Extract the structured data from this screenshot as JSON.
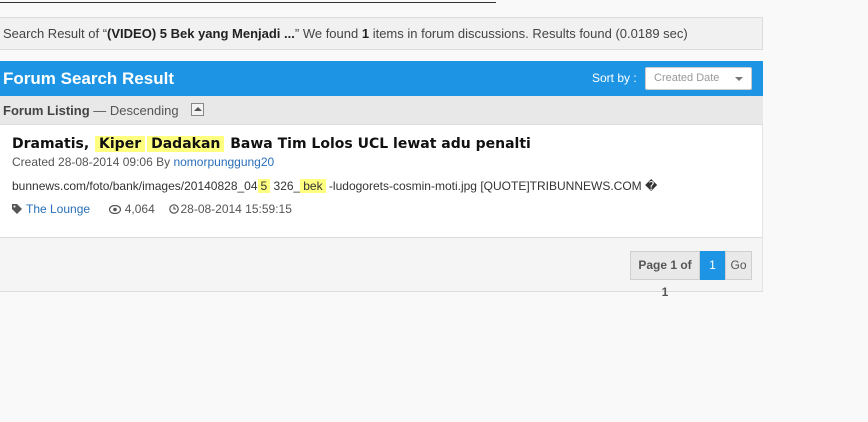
{
  "summary": {
    "prefix": "Search Result of “",
    "query": "(VIDEO) 5 Bek yang Menjadi ...",
    "middle": "” We found ",
    "count": "1",
    "suffix": " items in forum discussions. Results found (0.0189 sec)"
  },
  "header": {
    "title": "Forum Search Result",
    "sort_label": "Sort by :",
    "sort_value": "Created Date"
  },
  "listing": {
    "label": "Forum Listing",
    "order": " — Descending"
  },
  "result": {
    "title_parts": {
      "a": "Dramatis, ",
      "hl1": "Kiper",
      "hl2": "Dadakan",
      "b": " Bawa Tim Lolos UCL lewat adu penalti"
    },
    "created_prefix": "Created 28-08-2014 09:06 By ",
    "author": "nomorpunggung20",
    "snippet_parts": {
      "a": "bunnews.com/foto/bank/images/20140828_04",
      "hl1": "5",
      "b": " 326_",
      "hl2": "bek",
      "c": " -ludogorets-cosmin-moti.jpg [QUOTE]TRIBUNNEWS.COM �"
    },
    "forum": "The Lounge",
    "views": "4,064",
    "last_date": "28-08-2014 15:59:15"
  },
  "pager": {
    "info": "Page 1 of 1",
    "current": "1",
    "go": "Go"
  },
  "colors": {
    "accent": "#1e95e4",
    "highlight": "#ffff80",
    "link": "#2a70b8"
  }
}
